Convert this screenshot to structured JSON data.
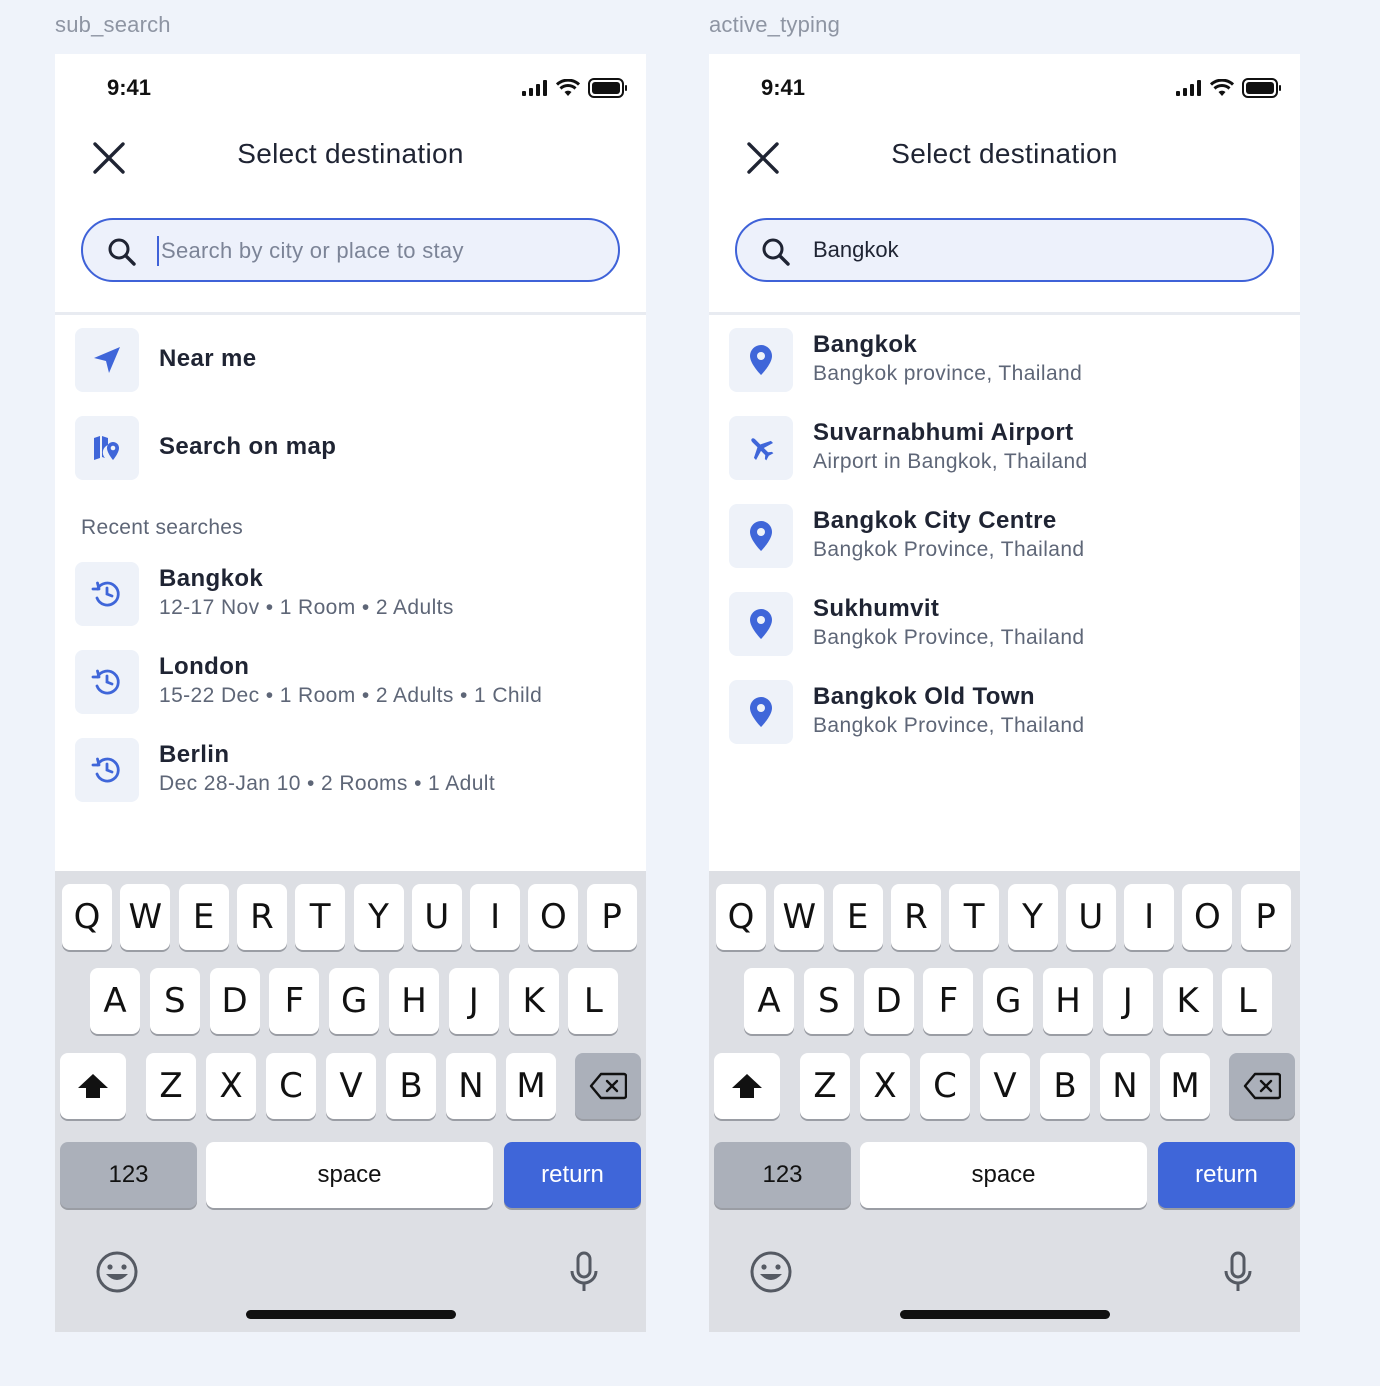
{
  "frames": {
    "left_label": "sub_search",
    "right_label": "active_typing"
  },
  "status": {
    "time": "9:41"
  },
  "header": {
    "title": "Select destination"
  },
  "left": {
    "search": {
      "placeholder": "Search by city or place to stay"
    },
    "options": [
      {
        "label": "Near me",
        "icon": "navigation-arrow-icon"
      },
      {
        "label": "Search on map",
        "icon": "map-pin-icon"
      }
    ],
    "recent_label": "Recent searches",
    "recent": [
      {
        "city": "Bangkok",
        "details": "12-17 Nov • 1 Room • 2 Adults"
      },
      {
        "city": "London",
        "details": "15-22 Dec • 1 Room • 2 Adults • 1 Child"
      },
      {
        "city": "Berlin",
        "details": "Dec 28-Jan 10 • 2 Rooms • 1 Adult"
      }
    ]
  },
  "right": {
    "search": {
      "value": "Bangkok"
    },
    "results": [
      {
        "name": "Bangkok",
        "sub": "Bangkok province, Thailand",
        "icon": "location-pin-icon"
      },
      {
        "name": "Suvarnabhumi Airport",
        "sub": "Airport in Bangkok, Thailand",
        "icon": "airplane-icon"
      },
      {
        "name": "Bangkok City Centre",
        "sub": "Bangkok Province, Thailand",
        "icon": "location-pin-icon"
      },
      {
        "name": "Sukhumvit",
        "sub": "Bangkok Province, Thailand",
        "icon": "location-pin-icon"
      },
      {
        "name": "Bangkok Old Town",
        "sub": "Bangkok Province, Thailand",
        "icon": "location-pin-icon"
      }
    ]
  },
  "keyboard": {
    "row1": [
      "Q",
      "W",
      "E",
      "R",
      "T",
      "Y",
      "U",
      "I",
      "O",
      "P"
    ],
    "row2": [
      "A",
      "S",
      "D",
      "F",
      "G",
      "H",
      "J",
      "K",
      "L"
    ],
    "row3": [
      "Z",
      "X",
      "C",
      "V",
      "B",
      "N",
      "M"
    ],
    "numbers": "123",
    "space": "space",
    "return": "return"
  },
  "colors": {
    "accent": "#3F66D9",
    "background": "#EFF3FA",
    "icon_bg": "#EEF2F9"
  }
}
